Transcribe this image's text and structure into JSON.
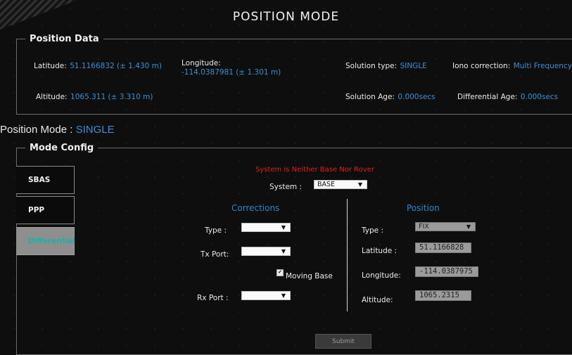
{
  "page": {
    "title": "POSITION MODE"
  },
  "position_data": {
    "legend": "Position Data",
    "latitude_label": "Latitude:",
    "latitude_value": "51.1166832 (± 1.430 m)",
    "longitude_label": "Longitude:",
    "longitude_value": "-114.0387981 (± 1.301 m)",
    "solution_type_label": "Solution type:",
    "solution_type_value": "SINGLE",
    "iono_label": "Iono correction:",
    "iono_value": "Multi Frequency",
    "altitude_label": "Altitude:",
    "altitude_value": "1065.311 (± 3.310 m)",
    "solution_age_label": "Solution Age:",
    "solution_age_value": "0.000secs",
    "diff_age_label": "Differential Age:",
    "diff_age_value": "0.000secs"
  },
  "mode": {
    "label": "Position Mode :",
    "value": "SINGLE"
  },
  "mode_config": {
    "legend": "Mode Config",
    "tabs": [
      {
        "label": "SBAS",
        "active": false
      },
      {
        "label": "PPP",
        "active": false
      },
      {
        "label": "Differential",
        "active": true
      }
    ],
    "warning": "System is Neither Base Nor Rover",
    "system_label": "System :",
    "system_value": "BASE",
    "corrections": {
      "header": "Corrections",
      "type_label": "Type :",
      "type_value": "",
      "tx_port_label": "Tx Port:",
      "tx_port_value": "",
      "moving_base_label": "Moving Base",
      "moving_base_checked": true,
      "rx_port_label": "Rx Port :",
      "rx_port_value": ""
    },
    "position": {
      "header": "Position",
      "type_label": "Type :",
      "type_value": "FIX",
      "latitude_label": "Latitude :",
      "latitude_value": "51.1166828",
      "longitude_label": "Longitude:",
      "longitude_value": "-114.0387975",
      "altitude_label": "Altitude:",
      "altitude_value": "1065.2315"
    },
    "submit_label": "Submit"
  },
  "colors": {
    "accent_blue": "#3d8fd8",
    "warning_red": "#e02020",
    "active_tab_text": "#16b3a8"
  }
}
